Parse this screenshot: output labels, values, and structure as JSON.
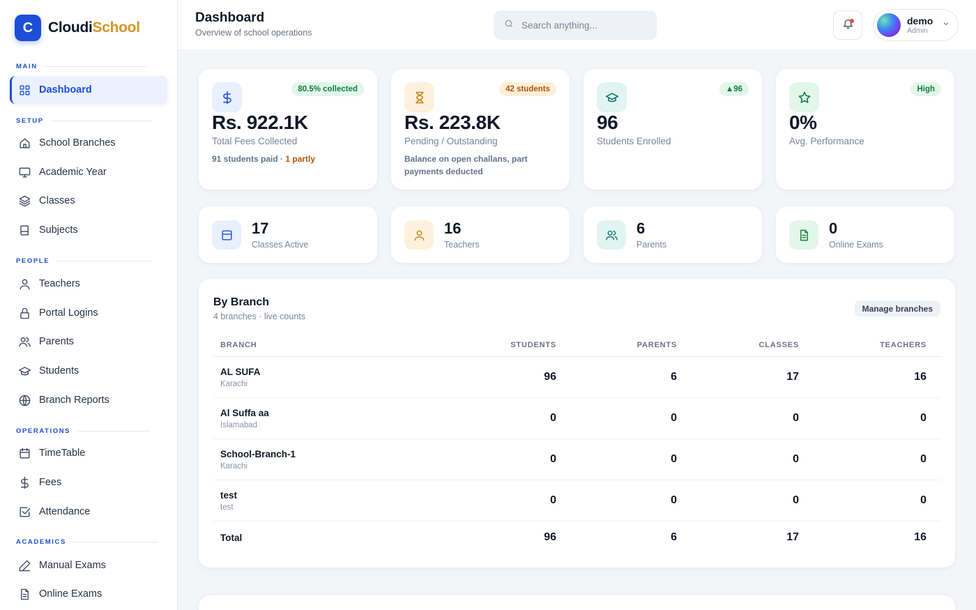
{
  "brand": {
    "logo_letter": "C",
    "name_part1": "Cloudi",
    "name_part2": "School"
  },
  "sidebar": {
    "sections": {
      "main": "MAIN",
      "setup": "SETUP",
      "people": "PEOPLE",
      "operations": "OPERATIONS",
      "academics": "ACADEMICS"
    },
    "items": {
      "dashboard": "Dashboard",
      "school_branches": "School Branches",
      "academic_year": "Academic Year",
      "classes": "Classes",
      "subjects": "Subjects",
      "teachers": "Teachers",
      "portal_logins": "Portal Logins",
      "parents": "Parents",
      "students": "Students",
      "branch_reports": "Branch Reports",
      "timetable": "TimeTable",
      "fees": "Fees",
      "attendance": "Attendance",
      "manual_exams": "Manual Exams",
      "online_exams": "Online Exams"
    }
  },
  "header": {
    "title": "Dashboard",
    "subtitle": "Overview of school operations",
    "search_placeholder": "Search anything...",
    "user_name": "demo",
    "user_role": "Admin"
  },
  "stats": {
    "fees": {
      "badge": "80.5% collected",
      "value": "Rs. 922.1K",
      "label": "Total Fees Collected",
      "note_main": "91 students paid · ",
      "note_hl": "1 partly"
    },
    "pending": {
      "badge": "42 students",
      "value": "Rs. 223.8K",
      "label": "Pending / Outstanding",
      "note": "Balance on open challans, part payments deducted"
    },
    "students": {
      "badge": "▲96",
      "value": "96",
      "label": "Students Enrolled"
    },
    "performance": {
      "badge": "High",
      "value": "0%",
      "label": "Avg. Performance"
    }
  },
  "mini": {
    "classes": {
      "value": "17",
      "label": "Classes Active"
    },
    "teachers": {
      "value": "16",
      "label": "Teachers"
    },
    "parents": {
      "value": "6",
      "label": "Parents"
    },
    "exams": {
      "value": "0",
      "label": "Online Exams"
    }
  },
  "branch": {
    "title": "By Branch",
    "subtitle": "4 branches · live counts",
    "manage_label": "Manage branches",
    "headers": [
      "BRANCH",
      "STUDENTS",
      "PARENTS",
      "CLASSES",
      "TEACHERS"
    ],
    "rows": [
      {
        "name": "AL SUFA",
        "city": "Karachi",
        "students": "96",
        "parents": "6",
        "classes": "17",
        "teachers": "16"
      },
      {
        "name": "Al Suffa aa",
        "city": "Islamabad",
        "students": "0",
        "parents": "0",
        "classes": "0",
        "teachers": "0"
      },
      {
        "name": "School-Branch-1",
        "city": "Karachi",
        "students": "0",
        "parents": "0",
        "classes": "0",
        "teachers": "0"
      },
      {
        "name": "test",
        "city": "test",
        "students": "0",
        "parents": "0",
        "classes": "0",
        "teachers": "0"
      }
    ],
    "total": {
      "name": "Total",
      "students": "96",
      "parents": "6",
      "classes": "17",
      "teachers": "16"
    }
  },
  "colors": {
    "accent": "#1d4ed8",
    "brand_gold": "#d69524",
    "green_badge": "#15803d",
    "amber_badge": "#b45309"
  }
}
